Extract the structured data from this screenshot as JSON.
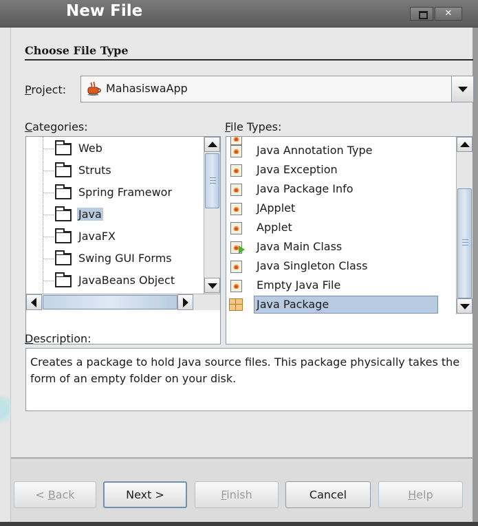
{
  "window": {
    "title": "New File"
  },
  "section": {
    "title": "Choose File Type"
  },
  "project": {
    "label_mnemonic": "P",
    "label_rest": "roject:",
    "value": "MahasiswaApp"
  },
  "categories": {
    "label_mnemonic": "C",
    "label_rest": "ategories:",
    "items": [
      {
        "label": "Web",
        "selected": false
      },
      {
        "label": "Struts",
        "selected": false
      },
      {
        "label": "Spring Framewor",
        "selected": false
      },
      {
        "label": "Java",
        "selected": true
      },
      {
        "label": "JavaFX",
        "selected": false
      },
      {
        "label": "Swing GUI Forms",
        "selected": false
      },
      {
        "label": "JavaBeans Object",
        "selected": false
      }
    ]
  },
  "file_types": {
    "label_mnemonic": "F",
    "label_rest": "ile Types:",
    "items": [
      {
        "label": "Java Annotation Type",
        "icon": "java-file-icon"
      },
      {
        "label": "Java Exception",
        "icon": "java-file-icon"
      },
      {
        "label": "Java Package Info",
        "icon": "java-file-icon"
      },
      {
        "label": "JApplet",
        "icon": "java-file-icon"
      },
      {
        "label": "Applet",
        "icon": "java-file-icon"
      },
      {
        "label": "Java Main Class",
        "icon": "java-main-class-icon"
      },
      {
        "label": "Java Singleton Class",
        "icon": "java-file-icon"
      },
      {
        "label": "Empty Java File",
        "icon": "java-file-icon"
      },
      {
        "label": "Java Package",
        "icon": "package-icon",
        "selected": true
      }
    ]
  },
  "description": {
    "label_mnemonic": "D",
    "label_rest": "escription:",
    "text": "Creates a package to hold Java source files. This package physically takes the form of an empty folder on your disk."
  },
  "buttons": {
    "back": {
      "prefix": "< ",
      "mnemonic": "B",
      "rest": "ack",
      "enabled": false
    },
    "next": {
      "label": "Next >",
      "enabled": true
    },
    "finish": {
      "mnemonic": "F",
      "rest": "inish",
      "enabled": false
    },
    "cancel": {
      "label": "Cancel",
      "enabled": true
    },
    "help": {
      "mnemonic": "H",
      "rest": "elp",
      "enabled": false
    }
  }
}
